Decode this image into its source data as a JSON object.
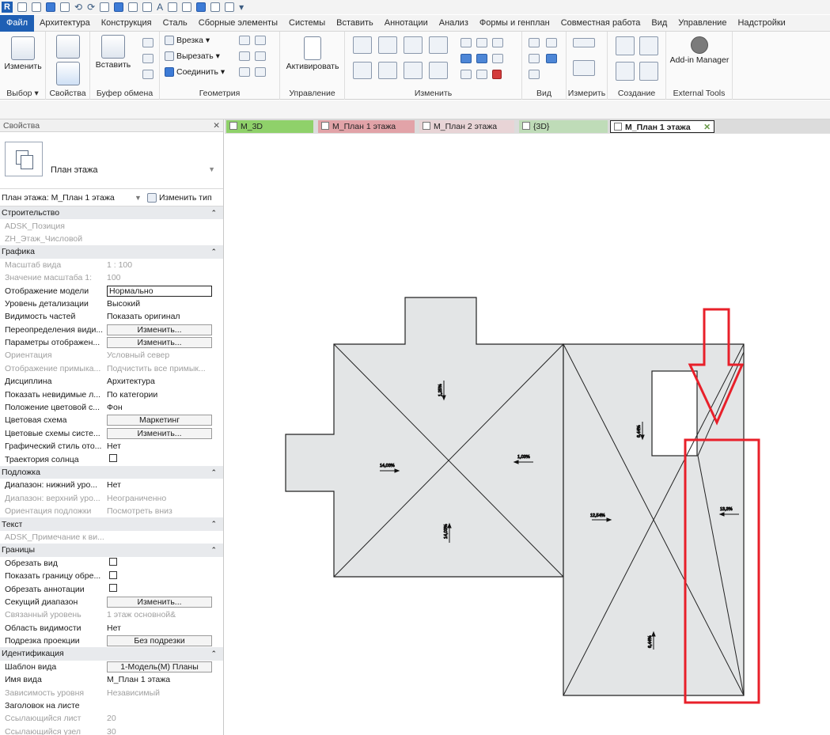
{
  "menu": {
    "file": "Файл",
    "tabs": [
      "Архитектура",
      "Конструкция",
      "Сталь",
      "Сборные элементы",
      "Системы",
      "Вставить",
      "Аннотации",
      "Анализ",
      "Формы и генплан",
      "Совместная работа",
      "Вид",
      "Управление",
      "Надстройки"
    ]
  },
  "ribbon": {
    "modify_label": "Изменить",
    "select_label": "Выбор ▾",
    "properties_label": "Свойства",
    "paste_label": "Вставить",
    "clipboard_label": "Буфер обмена",
    "cope_label": "Врезка ▾",
    "cut_label": "Вырезать ▾",
    "join_label": "Соединить ▾",
    "geometry_label": "Геометрия",
    "activate_label": "Активировать",
    "control_label": "Управление",
    "modify_panel_label": "Изменить",
    "view_panel_label": "Вид",
    "measure_label": "Измерить",
    "create_label": "Создание",
    "addin_manager_label": "Add-in Manager",
    "external_tools_label": "External Tools"
  },
  "properties": {
    "title": "Свойства",
    "type_name": "План этажа",
    "selector": "План этажа: М_План 1 этажа",
    "edit_type": "Изменить тип",
    "rows": [
      {
        "kind": "group",
        "k": "Строительство"
      },
      {
        "kind": "grey",
        "k": "ADSK_Позиция",
        "v": ""
      },
      {
        "kind": "grey",
        "k": "ZH_Этаж_Числовой",
        "v": ""
      },
      {
        "kind": "group",
        "k": "Графика"
      },
      {
        "kind": "grey",
        "k": "Масштаб вида",
        "v": "1 : 100"
      },
      {
        "kind": "grey",
        "k": "Значение масштаба   1:",
        "v": "100"
      },
      {
        "kind": "box",
        "k": "Отображение модели",
        "v": "Нормально"
      },
      {
        "kind": "text",
        "k": "Уровень детализации",
        "v": "Высокий"
      },
      {
        "kind": "text",
        "k": "Видимость частей",
        "v": "Показать оригинал"
      },
      {
        "kind": "button",
        "k": "Переопределения види...",
        "v": "Изменить..."
      },
      {
        "kind": "button",
        "k": "Параметры отображен...",
        "v": "Изменить..."
      },
      {
        "kind": "grey",
        "k": "Ориентация",
        "v": "Условный север"
      },
      {
        "kind": "grey",
        "k": "Отображение примыка...",
        "v": "Подчистить все примык..."
      },
      {
        "kind": "text",
        "k": "Дисциплина",
        "v": "Архитектура"
      },
      {
        "kind": "text",
        "k": "Показать невидимые л...",
        "v": "По категории"
      },
      {
        "kind": "text",
        "k": "Положение цветовой с...",
        "v": "Фон"
      },
      {
        "kind": "button",
        "k": "Цветовая схема",
        "v": "Маркетинг"
      },
      {
        "kind": "button",
        "k": "Цветовые схемы систе...",
        "v": "Изменить..."
      },
      {
        "kind": "text",
        "k": "Графический стиль ото...",
        "v": "Нет"
      },
      {
        "kind": "check",
        "k": "Траектория солнца",
        "v": ""
      },
      {
        "kind": "group",
        "k": "Подложка"
      },
      {
        "kind": "text",
        "k": "Диапазон: нижний уро...",
        "v": "Нет"
      },
      {
        "kind": "grey",
        "k": "Диапазон: верхний уро...",
        "v": "Неограниченно"
      },
      {
        "kind": "grey",
        "k": "Ориентация подложки",
        "v": "Посмотреть вниз"
      },
      {
        "kind": "group",
        "k": "Текст"
      },
      {
        "kind": "grey",
        "k": "ADSK_Примечание к ви...",
        "v": ""
      },
      {
        "kind": "group",
        "k": "Границы"
      },
      {
        "kind": "check",
        "k": "Обрезать вид",
        "v": ""
      },
      {
        "kind": "check",
        "k": "Показать границу обре...",
        "v": ""
      },
      {
        "kind": "check",
        "k": "Обрезать аннотации",
        "v": ""
      },
      {
        "kind": "button",
        "k": "Секущий диапазон",
        "v": "Изменить..."
      },
      {
        "kind": "grey",
        "k": "Связанный уровень",
        "v": "1 этаж основной&"
      },
      {
        "kind": "text",
        "k": "Область видимости",
        "v": "Нет"
      },
      {
        "kind": "button",
        "k": "Подрезка проекции",
        "v": "Без подрезки"
      },
      {
        "kind": "group",
        "k": "Идентификация"
      },
      {
        "kind": "button",
        "k": "Шаблон вида",
        "v": "1-Модель(М) Планы"
      },
      {
        "kind": "text",
        "k": "Имя вида",
        "v": "М_План 1 этажа"
      },
      {
        "kind": "grey",
        "k": "Зависимость уровня",
        "v": "Независимый"
      },
      {
        "kind": "text",
        "k": "Заголовок на листе",
        "v": ""
      },
      {
        "kind": "grey",
        "k": "Ссылающийся лист",
        "v": "20"
      },
      {
        "kind": "grey",
        "k": "Ссылающийся узел",
        "v": "30"
      }
    ]
  },
  "view_tabs": [
    {
      "label": "М_3D",
      "color": "#8fd16a",
      "active": false
    },
    {
      "label": "М_План 1 этажа",
      "color": "#e2a3a8",
      "active": false
    },
    {
      "label": "М_План 2 этажа",
      "color": "#e8d4d6",
      "active": false
    },
    {
      "label": "{3D}",
      "color": "#bfdcb8",
      "active": false
    },
    {
      "label": "М_План 1 этажа",
      "color": "#ffffff",
      "active": true
    }
  ],
  "slope_labels": [
    "14,03%",
    "1,03%",
    "1,25%",
    "14,03%",
    "12,54%",
    "6,44%",
    "13,3%",
    "6,44%"
  ],
  "colors": {
    "accent": "#1f5fb4",
    "highlight": "#e8202a",
    "roof_fill": "#e3e5e6"
  }
}
